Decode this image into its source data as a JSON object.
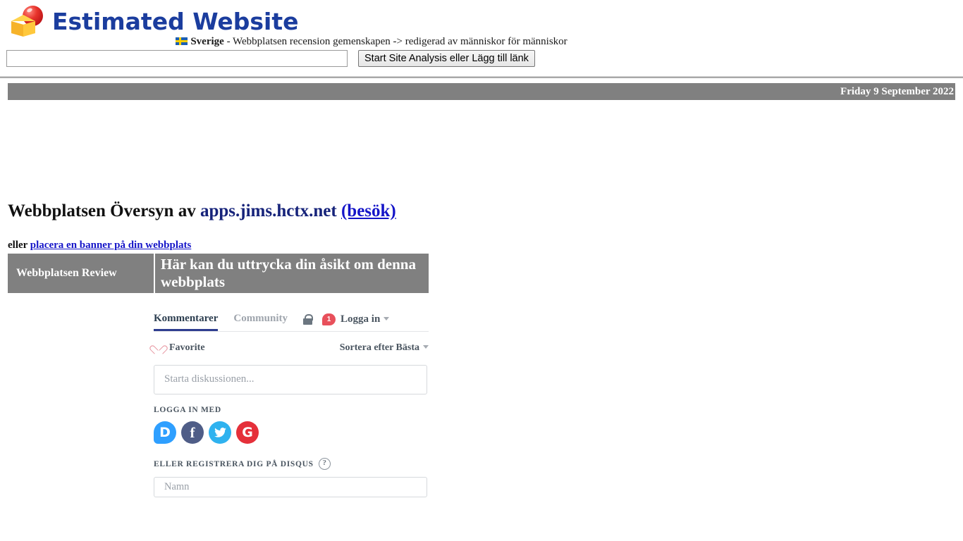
{
  "header": {
    "logo_text": "Estimated Website",
    "logo_icon": "red-sphere-yellow-cube-logo",
    "flag_icon": "sweden-flag-icon",
    "country": "Sverige",
    "tagline": " - Webbplatsen recension gemenskapen -> redigerad av människor för människor"
  },
  "search": {
    "value": "",
    "placeholder": "",
    "button_label": "Start Site Analysis eller Lägg till länk"
  },
  "date_bar": {
    "date": "Friday 9 September 2022",
    "bg_color": "#808080",
    "text_color": "#ffffff"
  },
  "main": {
    "title_prefix": "Webbplatsen Översyn av ",
    "title_domain": "apps.jims.hctx.net",
    "visit_link": "(besök)",
    "banner_prefix": "eller ",
    "banner_link": "placera en banner på din webbplats",
    "review_label": "Webbplatsen Review",
    "review_heading": "Här kan du uttrycka din åsikt om denna webbplats"
  },
  "disqus": {
    "tabs": [
      {
        "label": "Kommentarer",
        "active": true
      },
      {
        "label": "Community",
        "active": false
      }
    ],
    "lock_icon": "lock-icon",
    "badge_count": "1",
    "login_label": "Logga in",
    "favorite_label": "Favorite",
    "favorite_icon": "heart-icon",
    "sort_label": "Sortera efter Bästa",
    "editor_placeholder": "Starta diskussionen...",
    "login_with_label": "Logga in med",
    "socials": [
      {
        "name": "disqus",
        "glyph": "D",
        "color": "#2e9fff"
      },
      {
        "name": "facebook",
        "glyph": "f",
        "color": "#4f5d87"
      },
      {
        "name": "twitter",
        "glyph": "",
        "color": "#2fb2ef"
      },
      {
        "name": "google",
        "glyph": "G",
        "color": "#e5303a"
      }
    ],
    "register_label": "eller registrera dig på disqus",
    "help_icon": "question-mark-icon",
    "name_placeholder": "Namn",
    "accent_color": "#2e3d8f"
  }
}
